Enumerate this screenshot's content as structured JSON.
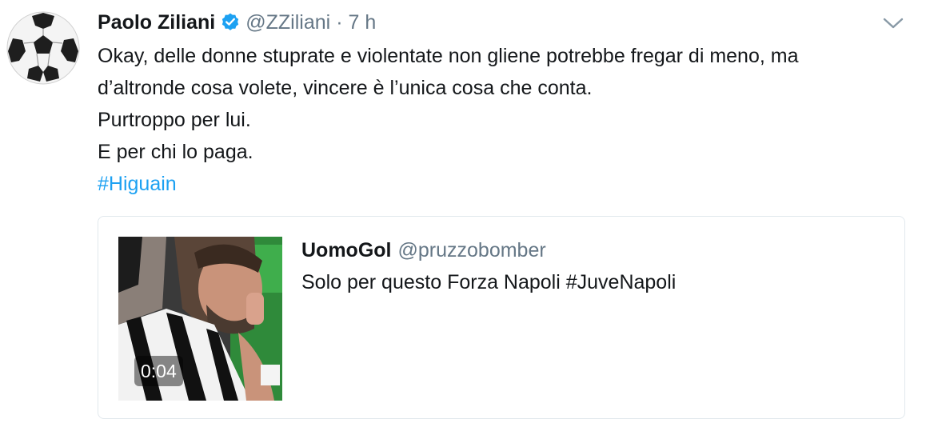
{
  "tweet": {
    "author_name": "Paolo Ziliani",
    "handle": "@ZZiliani",
    "separator": "·",
    "time": "7 h",
    "lines": [
      "Okay, delle donne stuprate e violentate non gliene potrebbe fregar di meno, ma",
      "d’altronde cosa volete, vincere è l’unica cosa che conta.",
      "Purtroppo per lui.",
      "E per chi lo paga."
    ],
    "hashtag": "#Higuain",
    "avatar_icon": "soccer-ball-icon",
    "verified_icon": "verified-badge-icon",
    "menu_icon": "chevron-down-icon"
  },
  "quoted": {
    "author_name": "UomoGol",
    "handle": "@pruzzobomber",
    "text": "Solo per questo Forza Napoli #JuveNapoli",
    "video_duration": "0:04"
  },
  "colors": {
    "link": "#1da1f2",
    "secondary_text": "#657786",
    "border": "#e1e8ed"
  }
}
